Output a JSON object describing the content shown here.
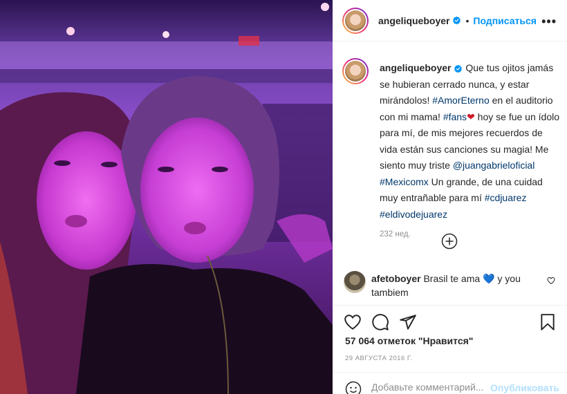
{
  "header": {
    "username": "angeliqueboyer",
    "dot": "•",
    "follow_label": "Подписаться",
    "more_label": "•••"
  },
  "caption": {
    "username": "angeliqueboyer",
    "text_1": " Que tus ojitos jamás se hubieran cerrado nunca, y estar mirándolos! ",
    "tag_1": "#AmorEterno",
    "text_2": " en el auditorio con mi mama! ",
    "tag_2": "#fans",
    "heart": "❤",
    "text_3": " hoy se fue un ídolo para mí, de mis mejores recuerdos de vida están sus canciones su magia! Me siento muy triste ",
    "mention_1": "@juangabrieloficial",
    "text_4": " ",
    "tag_3": "#Mexicomx",
    "text_5": " Un grande, de una cuidad muy entrañable para mí ",
    "tag_4": "#cdjuarez",
    "text_6": " ",
    "tag_5": "#eldivodejuarez",
    "time": "232 нед."
  },
  "comment": {
    "username": "afetoboyer",
    "text_1": " Brasil te ama ",
    "heart": "💙",
    "text_2": " y you tambiem"
  },
  "likes": "57 064 отметок \"Нравится\"",
  "date": "29 АВГУСТА 2016 Г.",
  "add_comment": {
    "placeholder": "Добавьте комментарий...",
    "publish_label": "Опубликовать"
  },
  "icons": {
    "verified": "verified-badge-icon",
    "like": "heart-outline-icon",
    "comment": "speech-bubble-icon",
    "share": "paper-plane-icon",
    "save": "bookmark-icon",
    "emoji": "smiley-icon",
    "load_more": "plus-circle-icon"
  },
  "colors": {
    "accent": "#0095f6",
    "hashtag": "#00376b",
    "muted": "#8e8e8e",
    "publish_disabled": "#b2dffc"
  }
}
